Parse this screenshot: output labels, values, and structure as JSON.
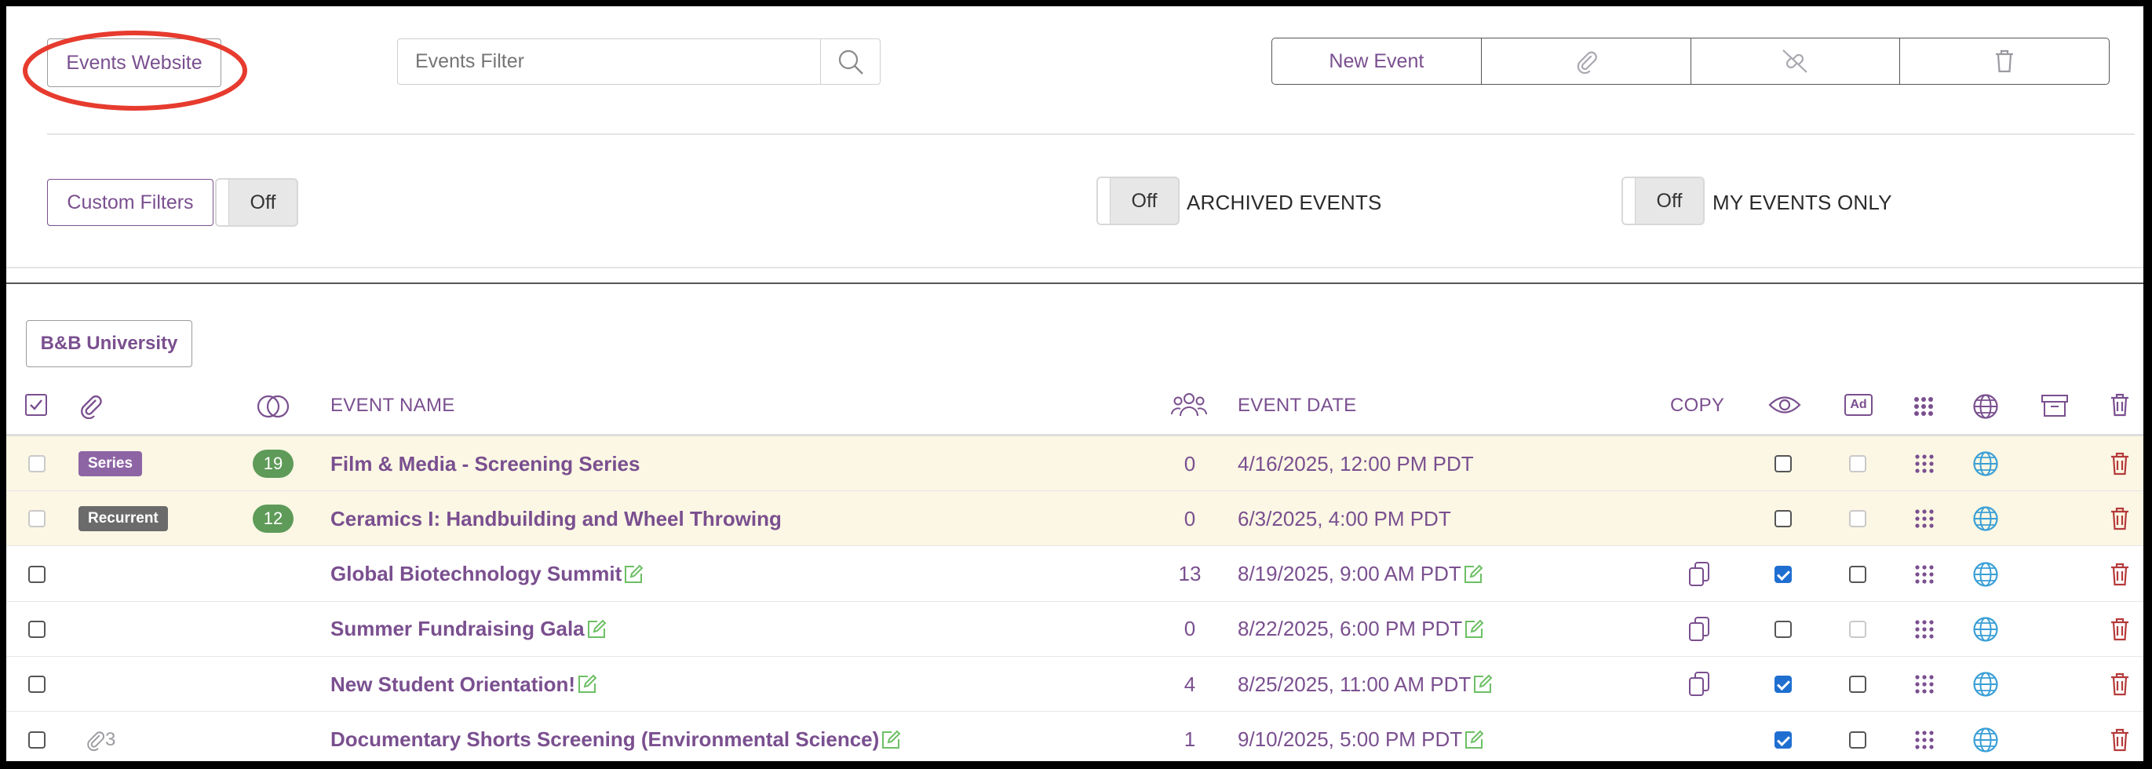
{
  "toolbar": {
    "events_website": "Events Website",
    "filter_placeholder": "Events Filter",
    "new_event": "New Event"
  },
  "filters": {
    "custom_filters": "Custom Filters",
    "custom_toggle": "Off",
    "archived_toggle": "Off",
    "archived_label": "ARCHIVED EVENTS",
    "my_toggle": "Off",
    "my_label": "MY EVENTS ONLY"
  },
  "org_button": "B&B University",
  "columns": {
    "event_name": "EVENT NAME",
    "event_date": "EVENT DATE",
    "copy": "COPY",
    "ad": "Ad"
  },
  "colors": {
    "accent": "#7a4f8f",
    "count_pill": "#5e9a58",
    "series_badge": "#8d64a4",
    "recurrent_badge": "#6b6b6b",
    "trash": "#b53a3a",
    "globe": "#3a9fd6",
    "highlight_row": "#fbf7e4",
    "circle_annotation": "#e63b2e"
  },
  "rows": [
    {
      "badge": "Series",
      "count": "19",
      "name": "Film & Media - Screening Series",
      "attendees": "0",
      "date": "4/16/2025, 12:00 PM PDT",
      "attachments": "",
      "editable": false,
      "copyable": false,
      "visible": false,
      "ad_enabled": false,
      "ad": false,
      "highlight": true
    },
    {
      "badge": "Recurrent",
      "count": "12",
      "name": "Ceramics I: Handbuilding and Wheel Throwing",
      "attendees": "0",
      "date": "6/3/2025, 4:00 PM PDT",
      "attachments": "",
      "editable": false,
      "copyable": false,
      "visible": false,
      "ad_enabled": false,
      "ad": false,
      "highlight": true
    },
    {
      "badge": "",
      "count": "",
      "name": "Global Biotechnology Summit",
      "attendees": "13",
      "date": "8/19/2025, 9:00 AM PDT",
      "attachments": "",
      "editable": true,
      "copyable": true,
      "visible": true,
      "ad_enabled": true,
      "ad": false,
      "highlight": false
    },
    {
      "badge": "",
      "count": "",
      "name": "Summer Fundraising Gala",
      "attendees": "0",
      "date": "8/22/2025, 6:00 PM PDT",
      "attachments": "",
      "editable": true,
      "copyable": true,
      "visible": false,
      "ad_enabled": false,
      "ad": false,
      "highlight": false
    },
    {
      "badge": "",
      "count": "",
      "name": "New Student Orientation!",
      "attendees": "4",
      "date": "8/25/2025, 11:00 AM PDT",
      "attachments": "",
      "editable": true,
      "copyable": true,
      "visible": true,
      "ad_enabled": true,
      "ad": false,
      "highlight": false
    },
    {
      "badge": "",
      "count": "",
      "name": "Documentary Shorts Screening (Environmental Science)",
      "attendees": "1",
      "date": "9/10/2025, 5:00 PM PDT",
      "attachments": "3",
      "editable": true,
      "copyable": false,
      "visible": true,
      "ad_enabled": true,
      "ad": false,
      "highlight": false
    }
  ]
}
